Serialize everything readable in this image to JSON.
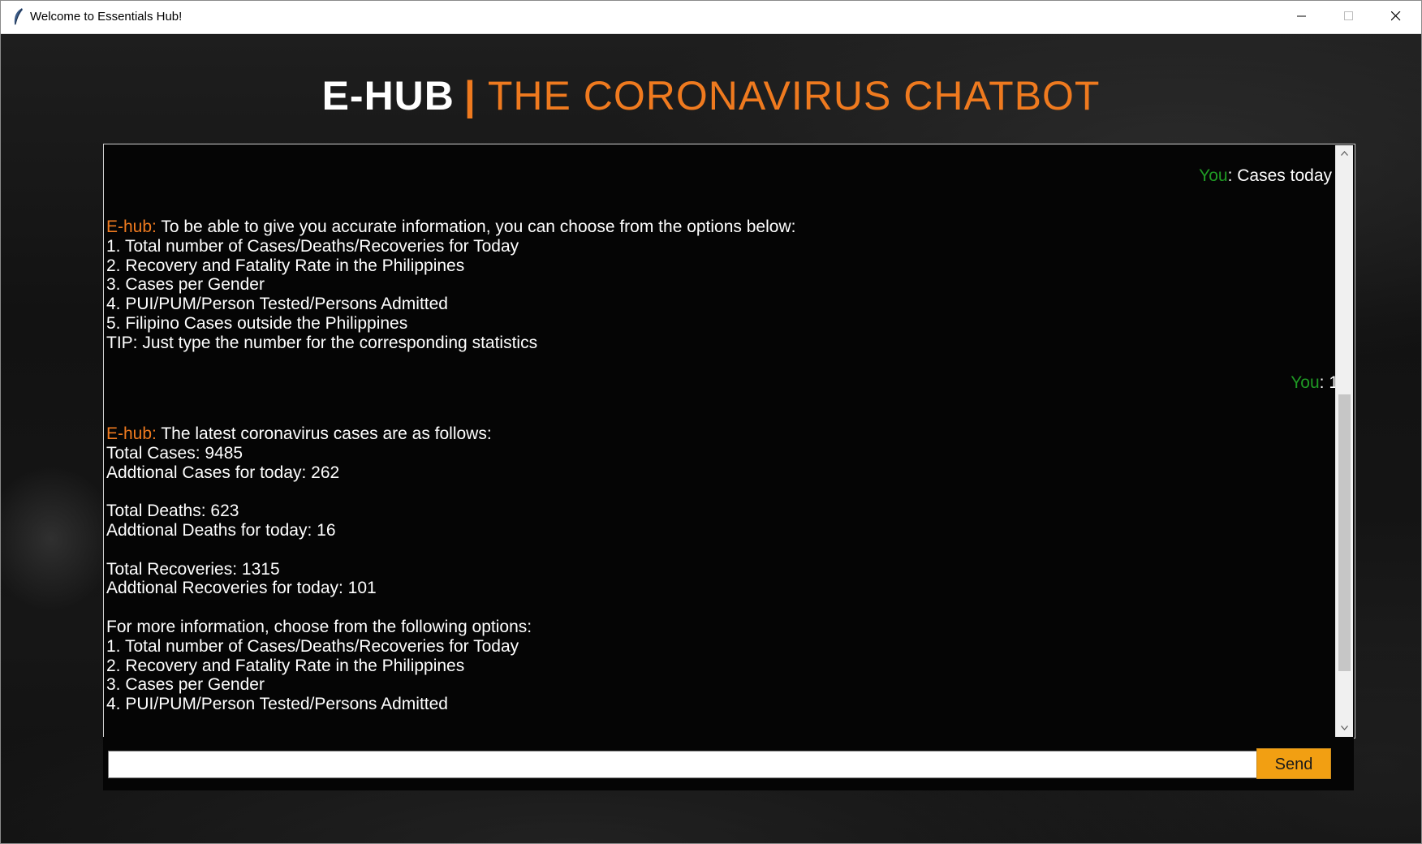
{
  "window": {
    "title": "Welcome to Essentials Hub!",
    "controls": {
      "minimize_icon": "minimize-icon",
      "maximize_icon": "maximize-icon",
      "close_icon": "close-icon"
    }
  },
  "header": {
    "brand": "E-HUB",
    "separator": "|",
    "subtitle": "THE CORONAVIRUS CHATBOT"
  },
  "colors": {
    "accent_orange": "#ef7a1f",
    "you_green": "#1f9a24",
    "send_button": "#f29f12",
    "chat_bg": "#050505"
  },
  "chat": {
    "messages": [
      {
        "sender": "You",
        "label": "You",
        "sep": ": ",
        "text": "Cases today"
      },
      {
        "sender": "E-hub",
        "label": "E-hub:",
        "first": " To be able to give you accurate information, you can choose from the options below:",
        "lines": [
          "1. Total number of Cases/Deaths/Recoveries for Today",
          "2. Recovery and Fatality Rate in the Philippines",
          "3. Cases per Gender",
          "4. PUI/PUM/Person Tested/Persons Admitted",
          "5. Filipino Cases outside the Philippines",
          "TIP: Just type the number for the corresponding statistics"
        ]
      },
      {
        "sender": "You",
        "label": "You",
        "sep": ": ",
        "text": "1"
      },
      {
        "sender": "E-hub",
        "label": "E-hub:",
        "first": " The latest coronavirus cases are as follows:",
        "lines": [
          "Total Cases: 9485",
          "Addtional Cases for today: 262",
          "",
          "Total Deaths: 623",
          "Addtional Deaths for today: 16",
          "",
          "Total Recoveries: 1315",
          "Addtional Recoveries for today: 101",
          "",
          "For more information, choose from the following options:",
          "1. Total number of Cases/Deaths/Recoveries for Today",
          "2. Recovery and Fatality Rate in the Philippines",
          "3. Cases per Gender",
          "4. PUI/PUM/Person Tested/Persons Admitted"
        ]
      }
    ]
  },
  "input": {
    "value": "",
    "placeholder": ""
  },
  "send_button": {
    "label": "Send"
  }
}
